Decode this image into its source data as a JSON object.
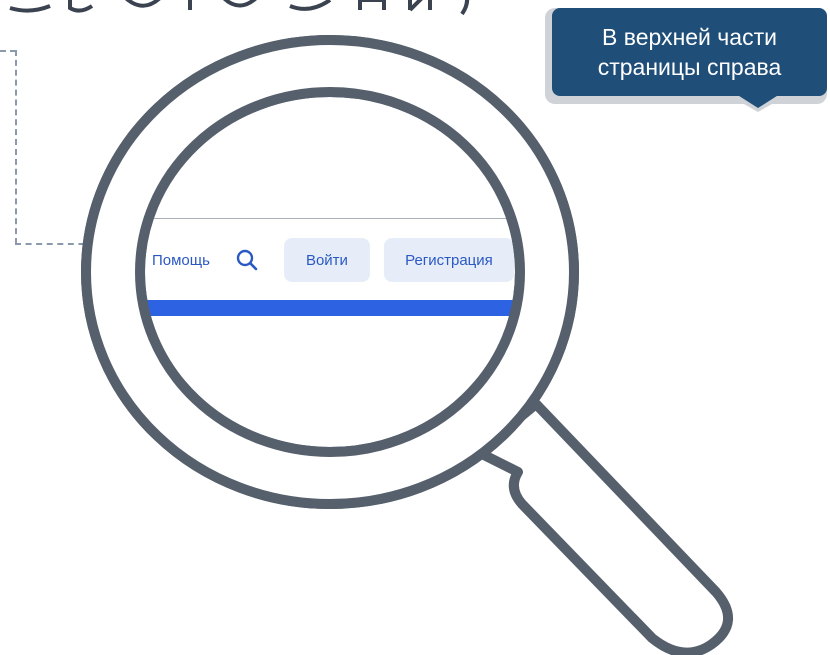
{
  "callout": {
    "line1": "В верхней части",
    "line2": "страницы справа"
  },
  "nav": {
    "help_label": "Помощь",
    "search_icon": "search-icon",
    "login_label": "Войти",
    "register_label": "Регистрация"
  },
  "colors": {
    "callout_bg": "#1f4e79",
    "magnifier_stroke": "#56606c",
    "link_blue": "#2b59c3",
    "button_bg": "#e6edf9",
    "bar_blue": "#2d63e3"
  }
}
